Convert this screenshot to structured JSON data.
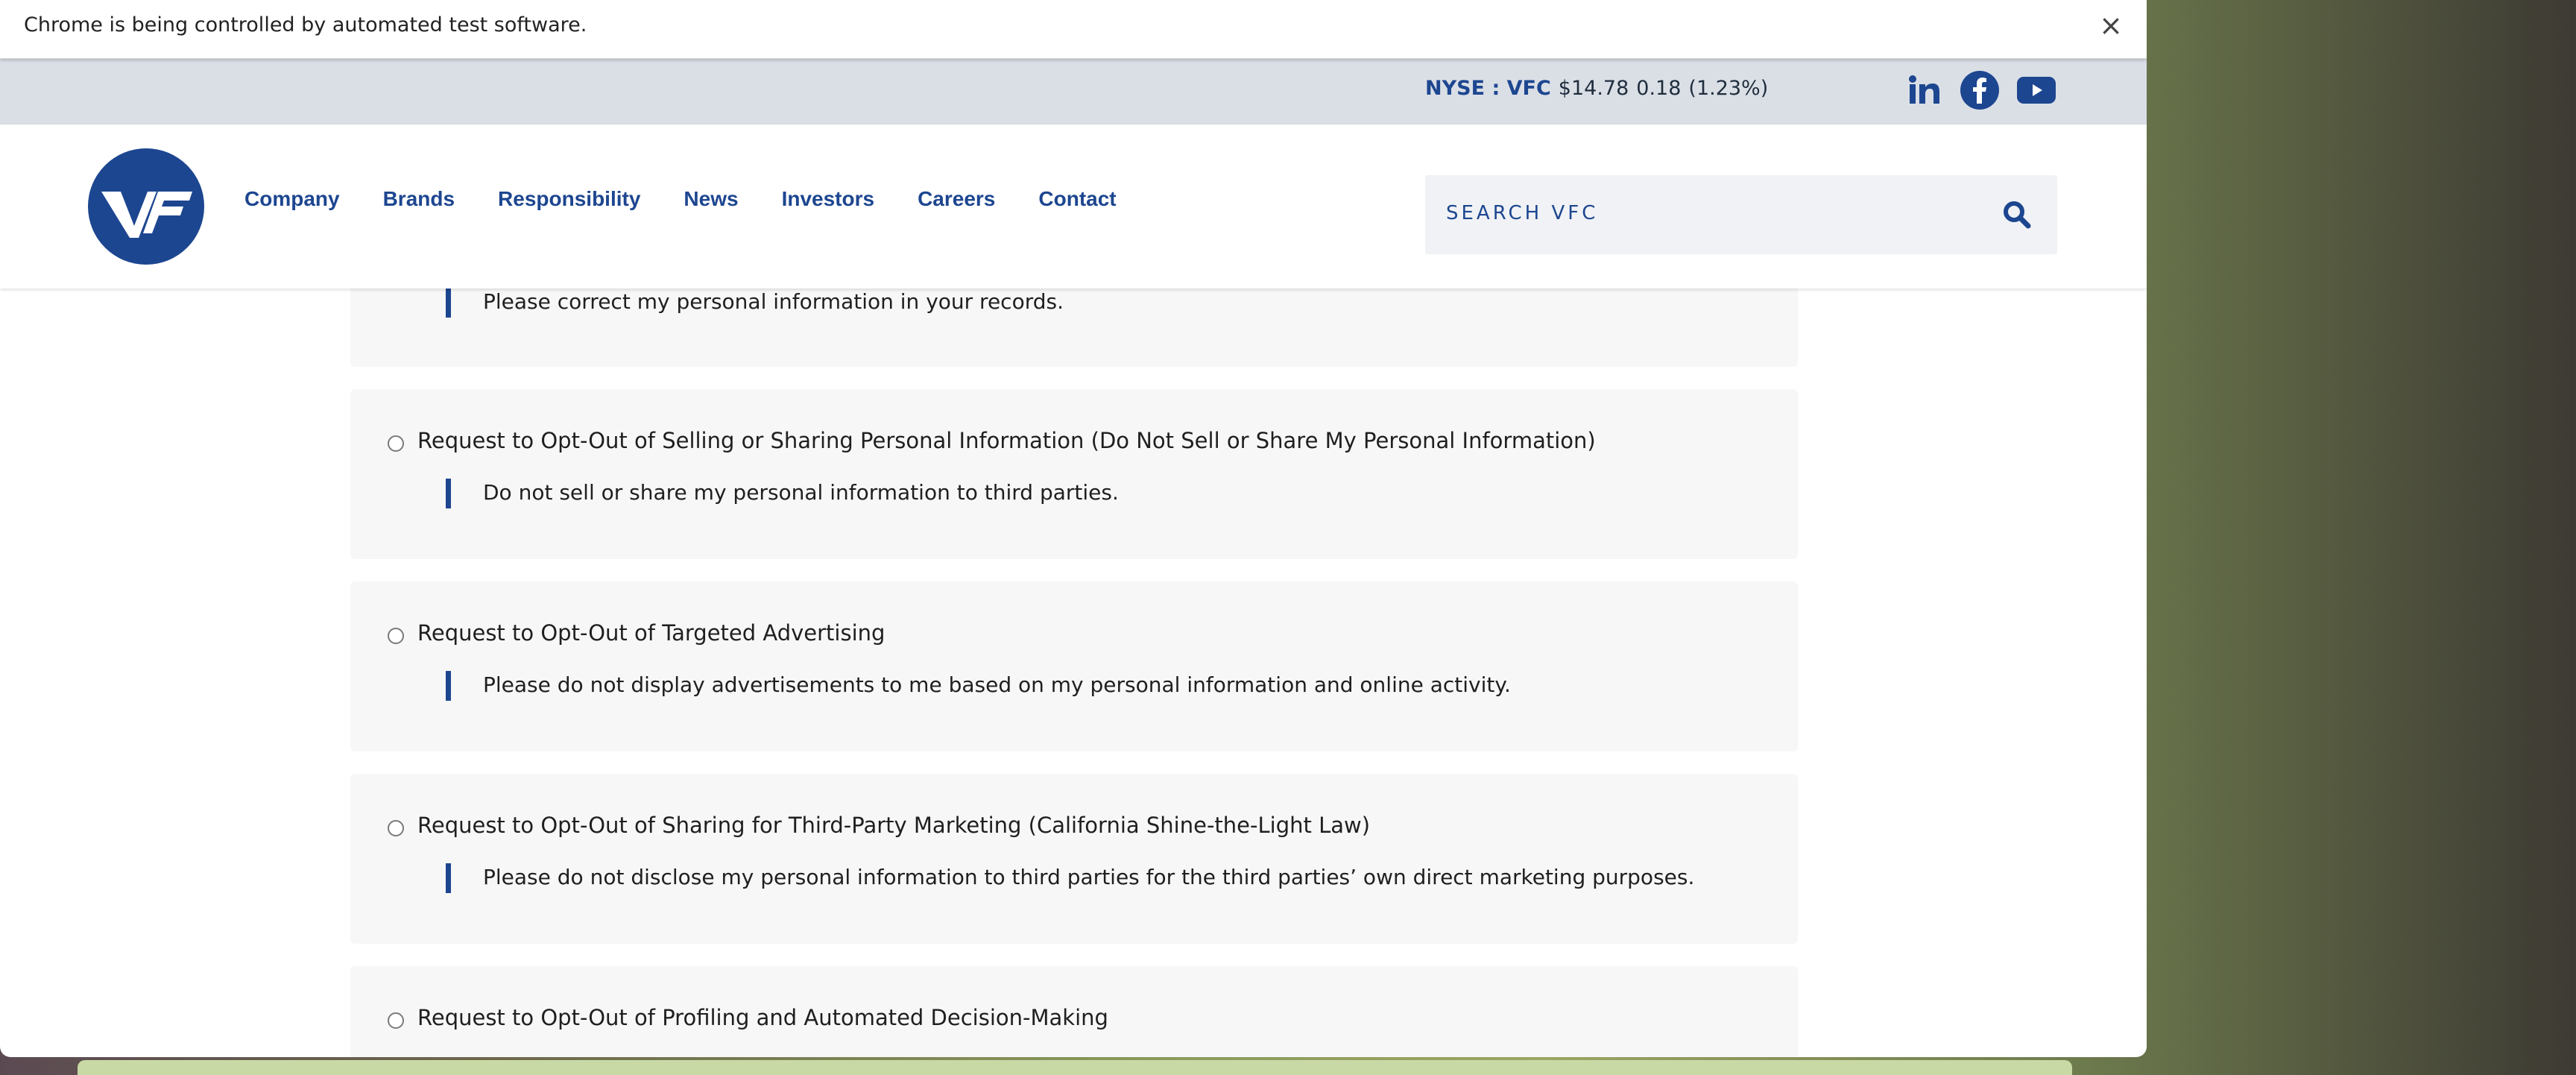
{
  "browser": {
    "automation_notice": "Chrome is being controlled by automated test software.",
    "close_label": "×"
  },
  "ticker": {
    "symbol": "NYSE : VFC",
    "price": "$14.78",
    "change": "0.18",
    "percent": "(1.23%)"
  },
  "social": [
    "linkedin-icon",
    "facebook-icon",
    "youtube-icon"
  ],
  "brand": {
    "logo_text": "VF",
    "color": "#1d4690"
  },
  "nav": {
    "items": [
      "Company",
      "Brands",
      "Responsibility",
      "News",
      "Investors",
      "Careers",
      "Contact"
    ]
  },
  "search": {
    "placeholder": "SEARCH VFC"
  },
  "options": [
    {
      "label": "",
      "description": "Please correct my personal information in your records.",
      "selected": false
    },
    {
      "label": "Request to Opt-Out of Selling or Sharing Personal Information (Do Not Sell or Share My Personal Information)",
      "description": "Do not sell or share my personal information to third parties.",
      "selected": false
    },
    {
      "label": "Request to Opt-Out of Targeted Advertising",
      "description": "Please do not display advertisements to me based on my personal information and online activity.",
      "selected": false
    },
    {
      "label": "Request to Opt-Out of Sharing for Third-Party Marketing (California Shine-the-Light Law)",
      "description": "Please do not disclose my personal information to third parties for the third parties’ own direct marketing purposes.",
      "selected": false
    },
    {
      "label": "Request to Opt-Out of Profiling and Automated Decision-Making",
      "description": "",
      "selected": false
    }
  ]
}
